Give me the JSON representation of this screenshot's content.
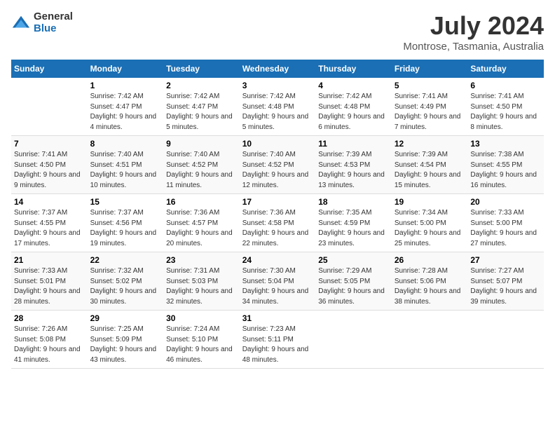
{
  "logo": {
    "general": "General",
    "blue": "Blue"
  },
  "title": "July 2024",
  "location": "Montrose, Tasmania, Australia",
  "days": [
    "Sunday",
    "Monday",
    "Tuesday",
    "Wednesday",
    "Thursday",
    "Friday",
    "Saturday"
  ],
  "weeks": [
    [
      {
        "date": "",
        "sunrise": "",
        "sunset": "",
        "daylight": ""
      },
      {
        "date": "1",
        "sunrise": "Sunrise: 7:42 AM",
        "sunset": "Sunset: 4:47 PM",
        "daylight": "Daylight: 9 hours and 4 minutes."
      },
      {
        "date": "2",
        "sunrise": "Sunrise: 7:42 AM",
        "sunset": "Sunset: 4:47 PM",
        "daylight": "Daylight: 9 hours and 5 minutes."
      },
      {
        "date": "3",
        "sunrise": "Sunrise: 7:42 AM",
        "sunset": "Sunset: 4:48 PM",
        "daylight": "Daylight: 9 hours and 5 minutes."
      },
      {
        "date": "4",
        "sunrise": "Sunrise: 7:42 AM",
        "sunset": "Sunset: 4:48 PM",
        "daylight": "Daylight: 9 hours and 6 minutes."
      },
      {
        "date": "5",
        "sunrise": "Sunrise: 7:41 AM",
        "sunset": "Sunset: 4:49 PM",
        "daylight": "Daylight: 9 hours and 7 minutes."
      },
      {
        "date": "6",
        "sunrise": "Sunrise: 7:41 AM",
        "sunset": "Sunset: 4:50 PM",
        "daylight": "Daylight: 9 hours and 8 minutes."
      }
    ],
    [
      {
        "date": "7",
        "sunrise": "Sunrise: 7:41 AM",
        "sunset": "Sunset: 4:50 PM",
        "daylight": "Daylight: 9 hours and 9 minutes."
      },
      {
        "date": "8",
        "sunrise": "Sunrise: 7:40 AM",
        "sunset": "Sunset: 4:51 PM",
        "daylight": "Daylight: 9 hours and 10 minutes."
      },
      {
        "date": "9",
        "sunrise": "Sunrise: 7:40 AM",
        "sunset": "Sunset: 4:52 PM",
        "daylight": "Daylight: 9 hours and 11 minutes."
      },
      {
        "date": "10",
        "sunrise": "Sunrise: 7:40 AM",
        "sunset": "Sunset: 4:52 PM",
        "daylight": "Daylight: 9 hours and 12 minutes."
      },
      {
        "date": "11",
        "sunrise": "Sunrise: 7:39 AM",
        "sunset": "Sunset: 4:53 PM",
        "daylight": "Daylight: 9 hours and 13 minutes."
      },
      {
        "date": "12",
        "sunrise": "Sunrise: 7:39 AM",
        "sunset": "Sunset: 4:54 PM",
        "daylight": "Daylight: 9 hours and 15 minutes."
      },
      {
        "date": "13",
        "sunrise": "Sunrise: 7:38 AM",
        "sunset": "Sunset: 4:55 PM",
        "daylight": "Daylight: 9 hours and 16 minutes."
      }
    ],
    [
      {
        "date": "14",
        "sunrise": "Sunrise: 7:37 AM",
        "sunset": "Sunset: 4:55 PM",
        "daylight": "Daylight: 9 hours and 17 minutes."
      },
      {
        "date": "15",
        "sunrise": "Sunrise: 7:37 AM",
        "sunset": "Sunset: 4:56 PM",
        "daylight": "Daylight: 9 hours and 19 minutes."
      },
      {
        "date": "16",
        "sunrise": "Sunrise: 7:36 AM",
        "sunset": "Sunset: 4:57 PM",
        "daylight": "Daylight: 9 hours and 20 minutes."
      },
      {
        "date": "17",
        "sunrise": "Sunrise: 7:36 AM",
        "sunset": "Sunset: 4:58 PM",
        "daylight": "Daylight: 9 hours and 22 minutes."
      },
      {
        "date": "18",
        "sunrise": "Sunrise: 7:35 AM",
        "sunset": "Sunset: 4:59 PM",
        "daylight": "Daylight: 9 hours and 23 minutes."
      },
      {
        "date": "19",
        "sunrise": "Sunrise: 7:34 AM",
        "sunset": "Sunset: 5:00 PM",
        "daylight": "Daylight: 9 hours and 25 minutes."
      },
      {
        "date": "20",
        "sunrise": "Sunrise: 7:33 AM",
        "sunset": "Sunset: 5:00 PM",
        "daylight": "Daylight: 9 hours and 27 minutes."
      }
    ],
    [
      {
        "date": "21",
        "sunrise": "Sunrise: 7:33 AM",
        "sunset": "Sunset: 5:01 PM",
        "daylight": "Daylight: 9 hours and 28 minutes."
      },
      {
        "date": "22",
        "sunrise": "Sunrise: 7:32 AM",
        "sunset": "Sunset: 5:02 PM",
        "daylight": "Daylight: 9 hours and 30 minutes."
      },
      {
        "date": "23",
        "sunrise": "Sunrise: 7:31 AM",
        "sunset": "Sunset: 5:03 PM",
        "daylight": "Daylight: 9 hours and 32 minutes."
      },
      {
        "date": "24",
        "sunrise": "Sunrise: 7:30 AM",
        "sunset": "Sunset: 5:04 PM",
        "daylight": "Daylight: 9 hours and 34 minutes."
      },
      {
        "date": "25",
        "sunrise": "Sunrise: 7:29 AM",
        "sunset": "Sunset: 5:05 PM",
        "daylight": "Daylight: 9 hours and 36 minutes."
      },
      {
        "date": "26",
        "sunrise": "Sunrise: 7:28 AM",
        "sunset": "Sunset: 5:06 PM",
        "daylight": "Daylight: 9 hours and 38 minutes."
      },
      {
        "date": "27",
        "sunrise": "Sunrise: 7:27 AM",
        "sunset": "Sunset: 5:07 PM",
        "daylight": "Daylight: 9 hours and 39 minutes."
      }
    ],
    [
      {
        "date": "28",
        "sunrise": "Sunrise: 7:26 AM",
        "sunset": "Sunset: 5:08 PM",
        "daylight": "Daylight: 9 hours and 41 minutes."
      },
      {
        "date": "29",
        "sunrise": "Sunrise: 7:25 AM",
        "sunset": "Sunset: 5:09 PM",
        "daylight": "Daylight: 9 hours and 43 minutes."
      },
      {
        "date": "30",
        "sunrise": "Sunrise: 7:24 AM",
        "sunset": "Sunset: 5:10 PM",
        "daylight": "Daylight: 9 hours and 46 minutes."
      },
      {
        "date": "31",
        "sunrise": "Sunrise: 7:23 AM",
        "sunset": "Sunset: 5:11 PM",
        "daylight": "Daylight: 9 hours and 48 minutes."
      },
      {
        "date": "",
        "sunrise": "",
        "sunset": "",
        "daylight": ""
      },
      {
        "date": "",
        "sunrise": "",
        "sunset": "",
        "daylight": ""
      },
      {
        "date": "",
        "sunrise": "",
        "sunset": "",
        "daylight": ""
      }
    ]
  ]
}
